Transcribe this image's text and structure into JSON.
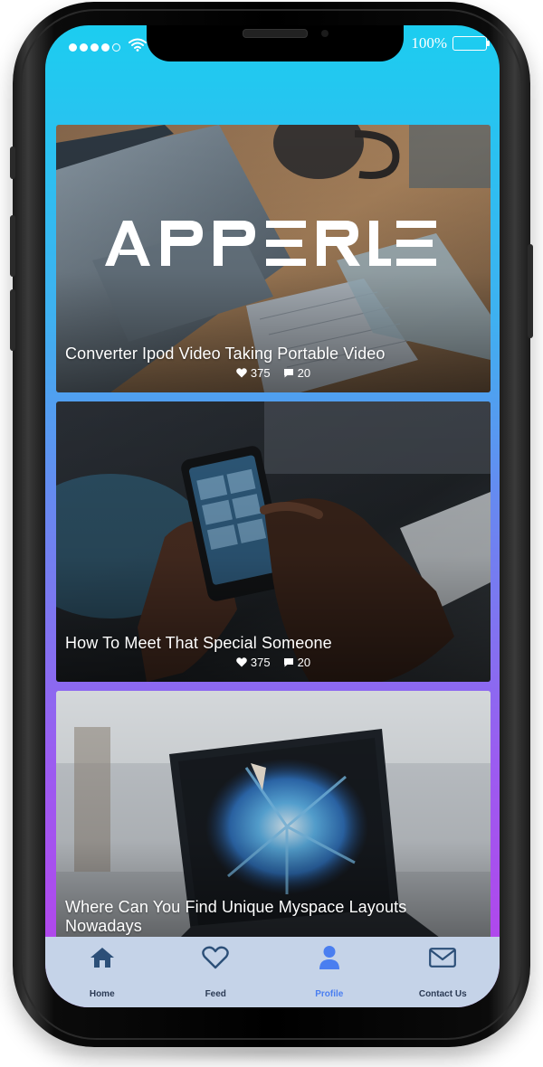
{
  "status_bar": {
    "battery_text": "100%",
    "signal_dots_filled": 4,
    "signal_dots_total": 5
  },
  "colors": {
    "gradient_top": "#1ccdf0",
    "gradient_bottom": "#b840ea",
    "tabbar_bg": "#c5d3e8",
    "tab_active": "#4a7ef0",
    "tab_inactive": "#2c3b55"
  },
  "brand": {
    "logo_text": "APPERLE"
  },
  "cards": [
    {
      "title": "Converter Ipod Video Taking Portable Video",
      "likes": "375",
      "comments": "20",
      "scene": "laptop-desk"
    },
    {
      "title": "How To Meet That Special Someone",
      "likes": "375",
      "comments": "20",
      "scene": "phone-in-hands"
    },
    {
      "title": "Where Can You Find Unique Myspace Layouts Nowadays",
      "scene": "laptop-blue-splash"
    }
  ],
  "tabbar": {
    "items": [
      {
        "label": "Home",
        "icon": "home-icon",
        "active": false
      },
      {
        "label": "Feed",
        "icon": "heart-icon",
        "active": false
      },
      {
        "label": "Profile",
        "icon": "user-icon",
        "active": true
      },
      {
        "label": "Contact Us",
        "icon": "envelope-icon",
        "active": false
      }
    ]
  }
}
